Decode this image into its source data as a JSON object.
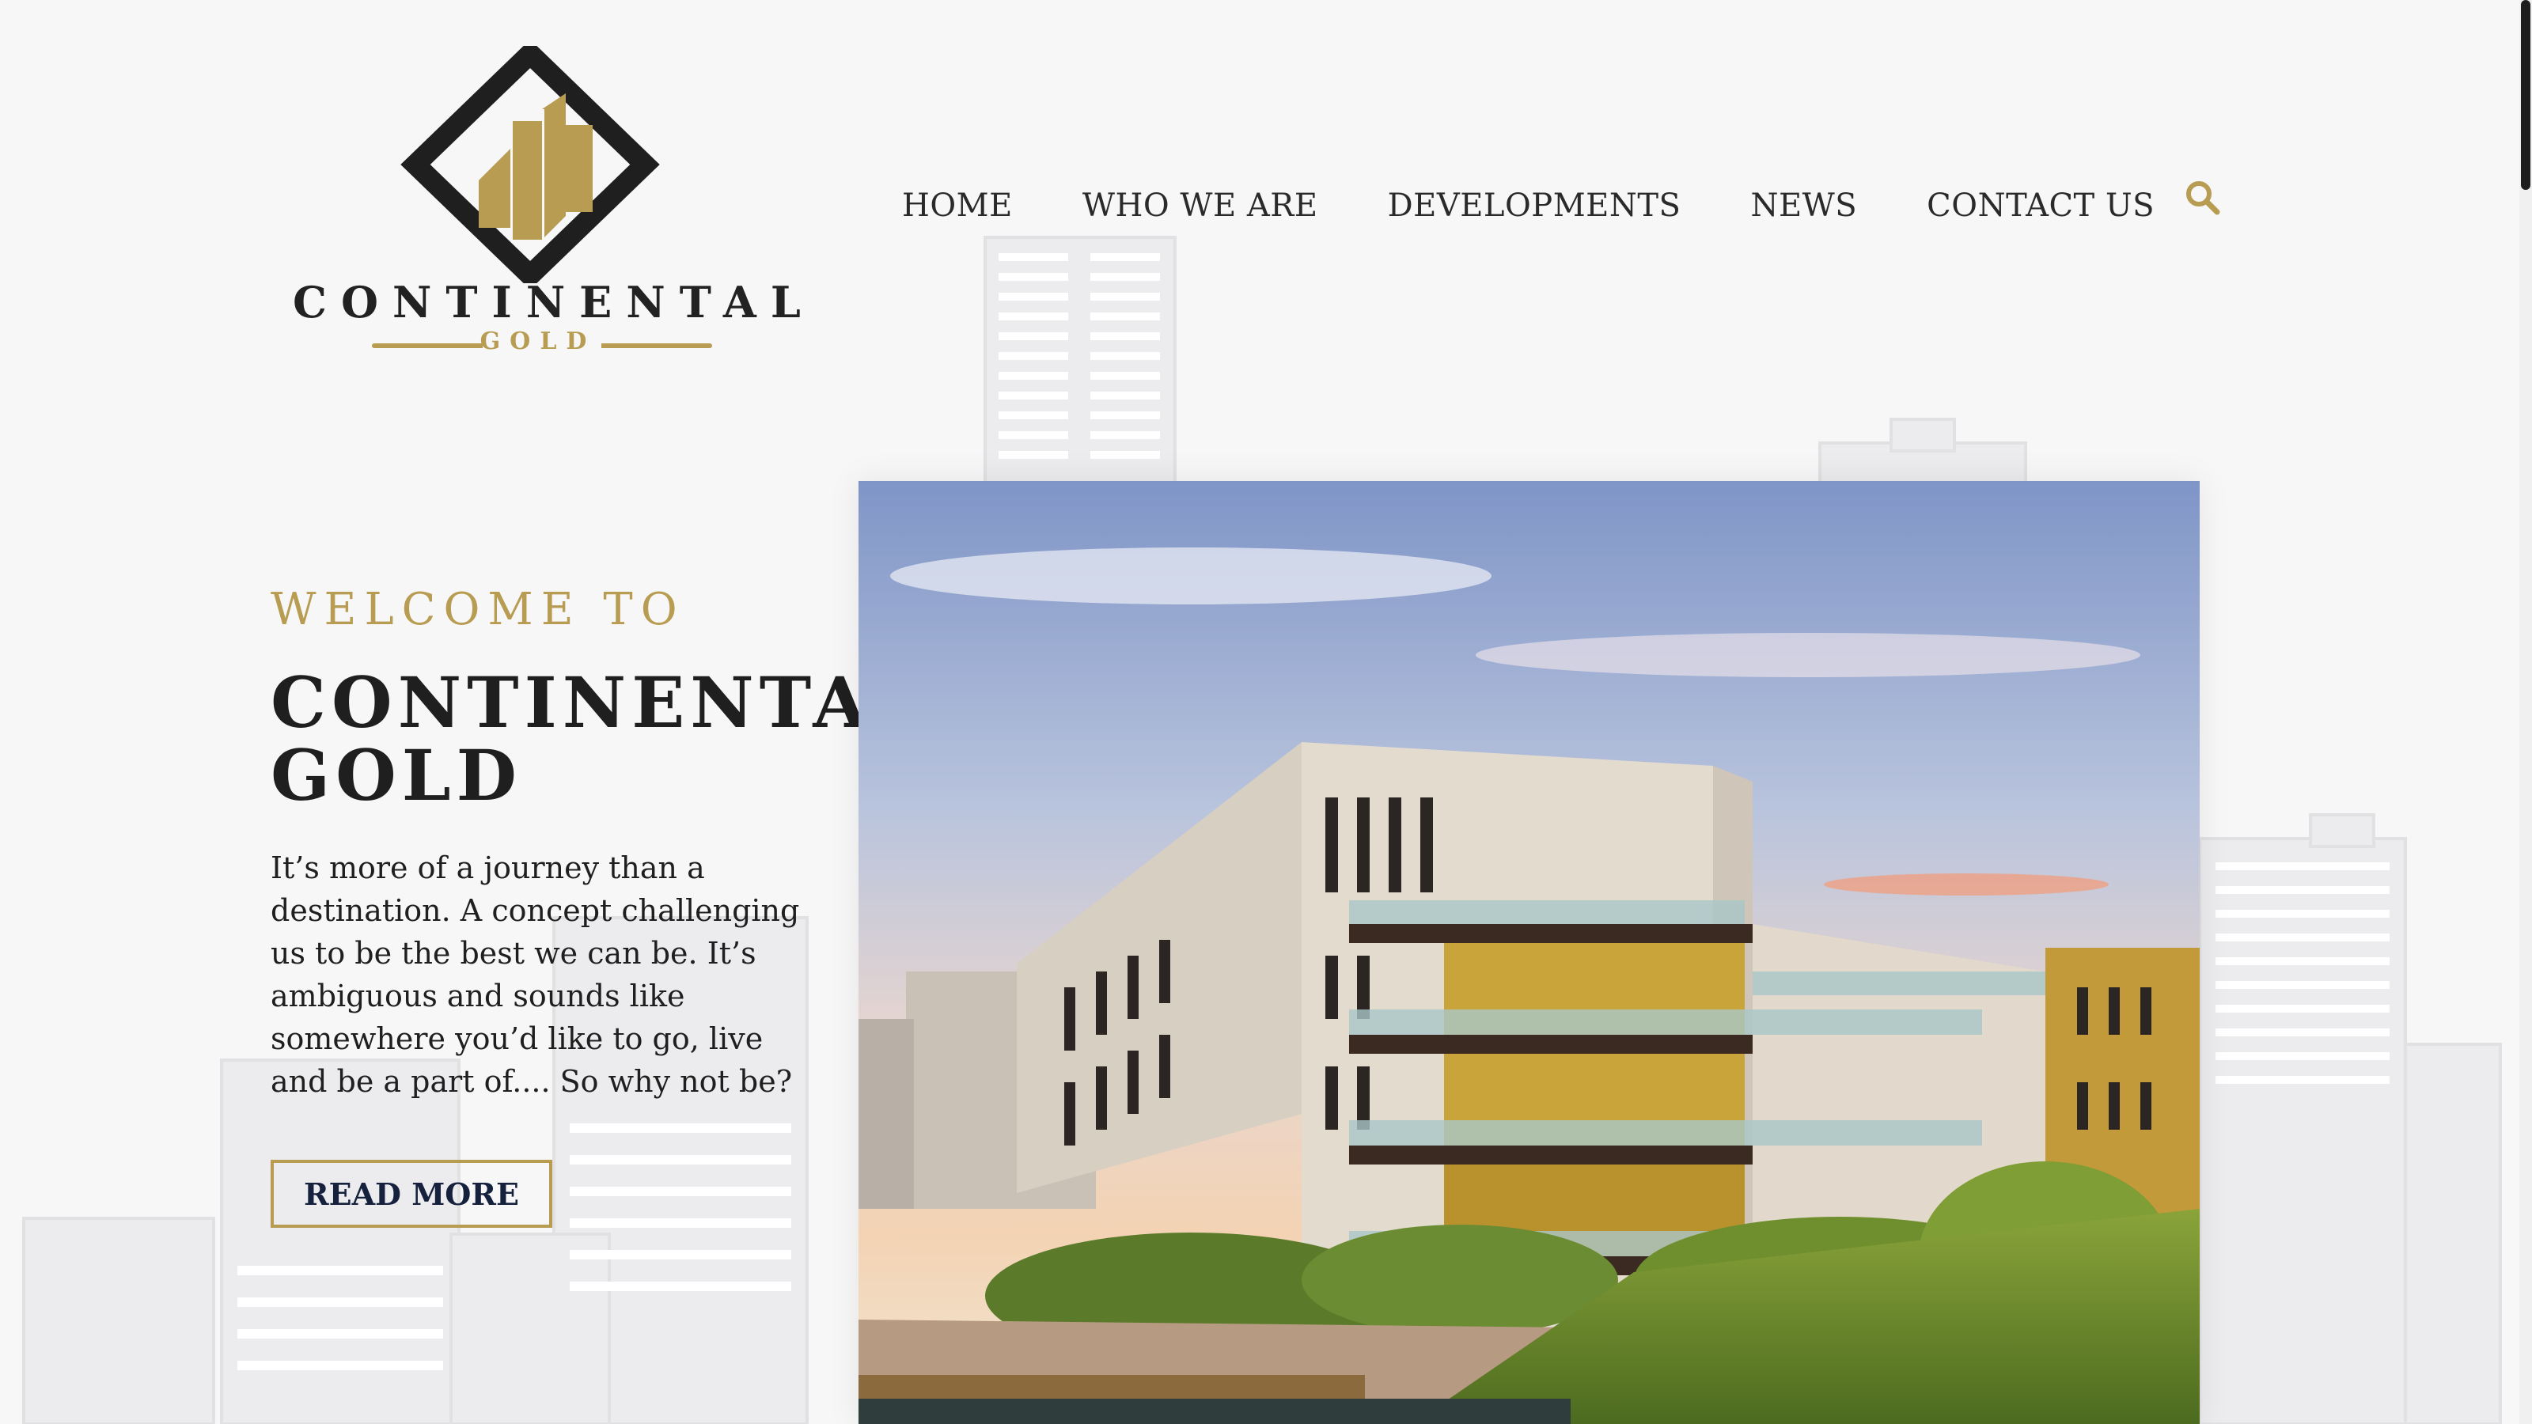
{
  "header": {
    "logo": {
      "name": "CONTINENTAL",
      "sub": "GOLD"
    },
    "nav": [
      {
        "label": "HOME"
      },
      {
        "label": "WHO WE ARE"
      },
      {
        "label": "DEVELOPMENTS"
      },
      {
        "label": "NEWS"
      },
      {
        "label": "CONTACT US"
      }
    ],
    "search_icon": "search-icon"
  },
  "hero": {
    "kicker": "WELCOME TO",
    "title_line1": "CONTINENTAL",
    "title_line2": "GOLD",
    "text": "It’s more of a journey than a destination. A concept challenging us to be the best we can be. It’s ambiguous and sounds like somewhere you’d like to go, live and be a part of.... So why not be?",
    "button": "READ MORE"
  },
  "colors": {
    "gold": "#b89c52",
    "dark": "#1f1f1f",
    "navy": "#16213d",
    "background": "#f7f7f8"
  }
}
